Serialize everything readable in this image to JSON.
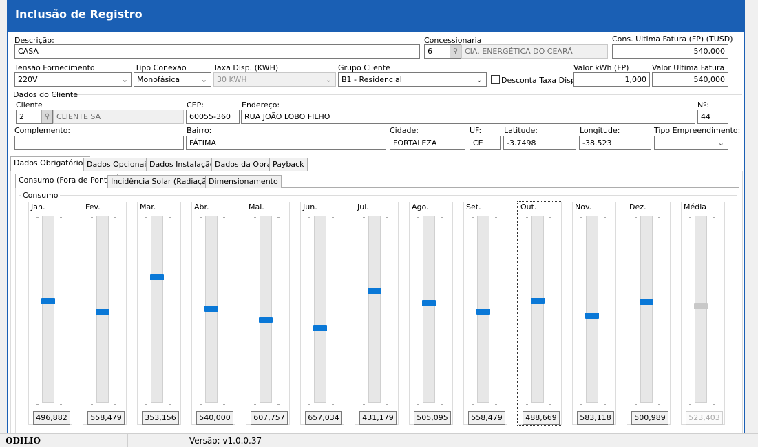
{
  "window": {
    "title": "Inclusão de Registro"
  },
  "form": {
    "descricao_label": "Descrição:",
    "descricao_value": "CASA",
    "concessionaria_label": "Concessionaria",
    "concessionaria_code": "6",
    "concessionaria_name": "CIA. ENERGÉTICA DO CEARÁ",
    "cons_ultima_label": "Cons. Ultima Fatura (FP) (TUSD)",
    "cons_ultima_value": "540,000",
    "tensao_label": "Tensão Fornecimento",
    "tensao_value": "220V",
    "tipo_conexao_label": "Tipo Conexão",
    "tipo_conexao_value": "Monofásica",
    "taxa_disp_label": "Taxa Disp. (KWH)",
    "taxa_disp_value": "30 KWH",
    "grupo_cliente_label": "Grupo Cliente",
    "grupo_cliente_value": "B1 - Residencial",
    "desconta_taxa_label": "Desconta Taxa Disp.",
    "valor_kwh_label": "Valor kWh (FP)",
    "valor_kwh_value": "1,000",
    "valor_ultima_label": "Valor Ultima Fatura",
    "valor_ultima_value": "540,000"
  },
  "cliente": {
    "section_label": "Dados do Cliente",
    "cliente_label": "Cliente",
    "cliente_code": "2",
    "cliente_name": "CLIENTE SA",
    "cep_label": "CEP:",
    "cep_value": "60055-360",
    "endereco_label": "Endereço:",
    "endereco_value": "RUA JOÃO LOBO FILHO",
    "numero_label": "Nº:",
    "numero_value": "44",
    "complemento_label": "Complemento:",
    "complemento_value": "",
    "bairro_label": "Bairro:",
    "bairro_value": "FÁTIMA",
    "cidade_label": "Cidade:",
    "cidade_value": "FORTALEZA",
    "uf_label": "UF:",
    "uf_value": "CE",
    "latitude_label": "Latitude:",
    "latitude_value": "-3.7498",
    "longitude_label": "Longitude:",
    "longitude_value": "-38.523",
    "tipo_emp_label": "Tipo Empreendimento:",
    "tipo_emp_value": ""
  },
  "tabs": [
    "Dados Obrigatórios",
    "Dados Opcionais",
    "Dados Instalação",
    "Dados da Obra",
    "Payback"
  ],
  "subtabs": [
    "Consumo (Fora de Ponta)",
    "Incidência Solar (Radiação)",
    "Dimensionamento"
  ],
  "consumo": {
    "group_label": "Consumo",
    "months": [
      {
        "label": "Jan.",
        "value": "496,882",
        "level": 0.546
      },
      {
        "label": "Fev.",
        "value": "558,479",
        "level": 0.489
      },
      {
        "label": "Mar.",
        "value": "353,156",
        "level": 0.679
      },
      {
        "label": "Abr.",
        "value": "540,000",
        "level": 0.506
      },
      {
        "label": "Mai.",
        "value": "607,757",
        "level": 0.443
      },
      {
        "label": "Jun.",
        "value": "657,034",
        "level": 0.398
      },
      {
        "label": "Jul.",
        "value": "431,179",
        "level": 0.606
      },
      {
        "label": "Ago.",
        "value": "505,095",
        "level": 0.538
      },
      {
        "label": "Set.",
        "value": "558,479",
        "level": 0.489
      },
      {
        "label": "Out.",
        "value": "488,669",
        "level": 0.553
      },
      {
        "label": "Nov.",
        "value": "583,118",
        "level": 0.466
      },
      {
        "label": "Dez.",
        "value": "500,989",
        "level": 0.542
      },
      {
        "label": "Média",
        "value": "523,403",
        "level": 0.521
      }
    ]
  },
  "statusbar": {
    "user": "ODILIO",
    "version": "Versão: v1.0.0.37"
  },
  "colors": {
    "titlebar": "#1a5fb4",
    "slider_thumb": "#0a78d7"
  }
}
